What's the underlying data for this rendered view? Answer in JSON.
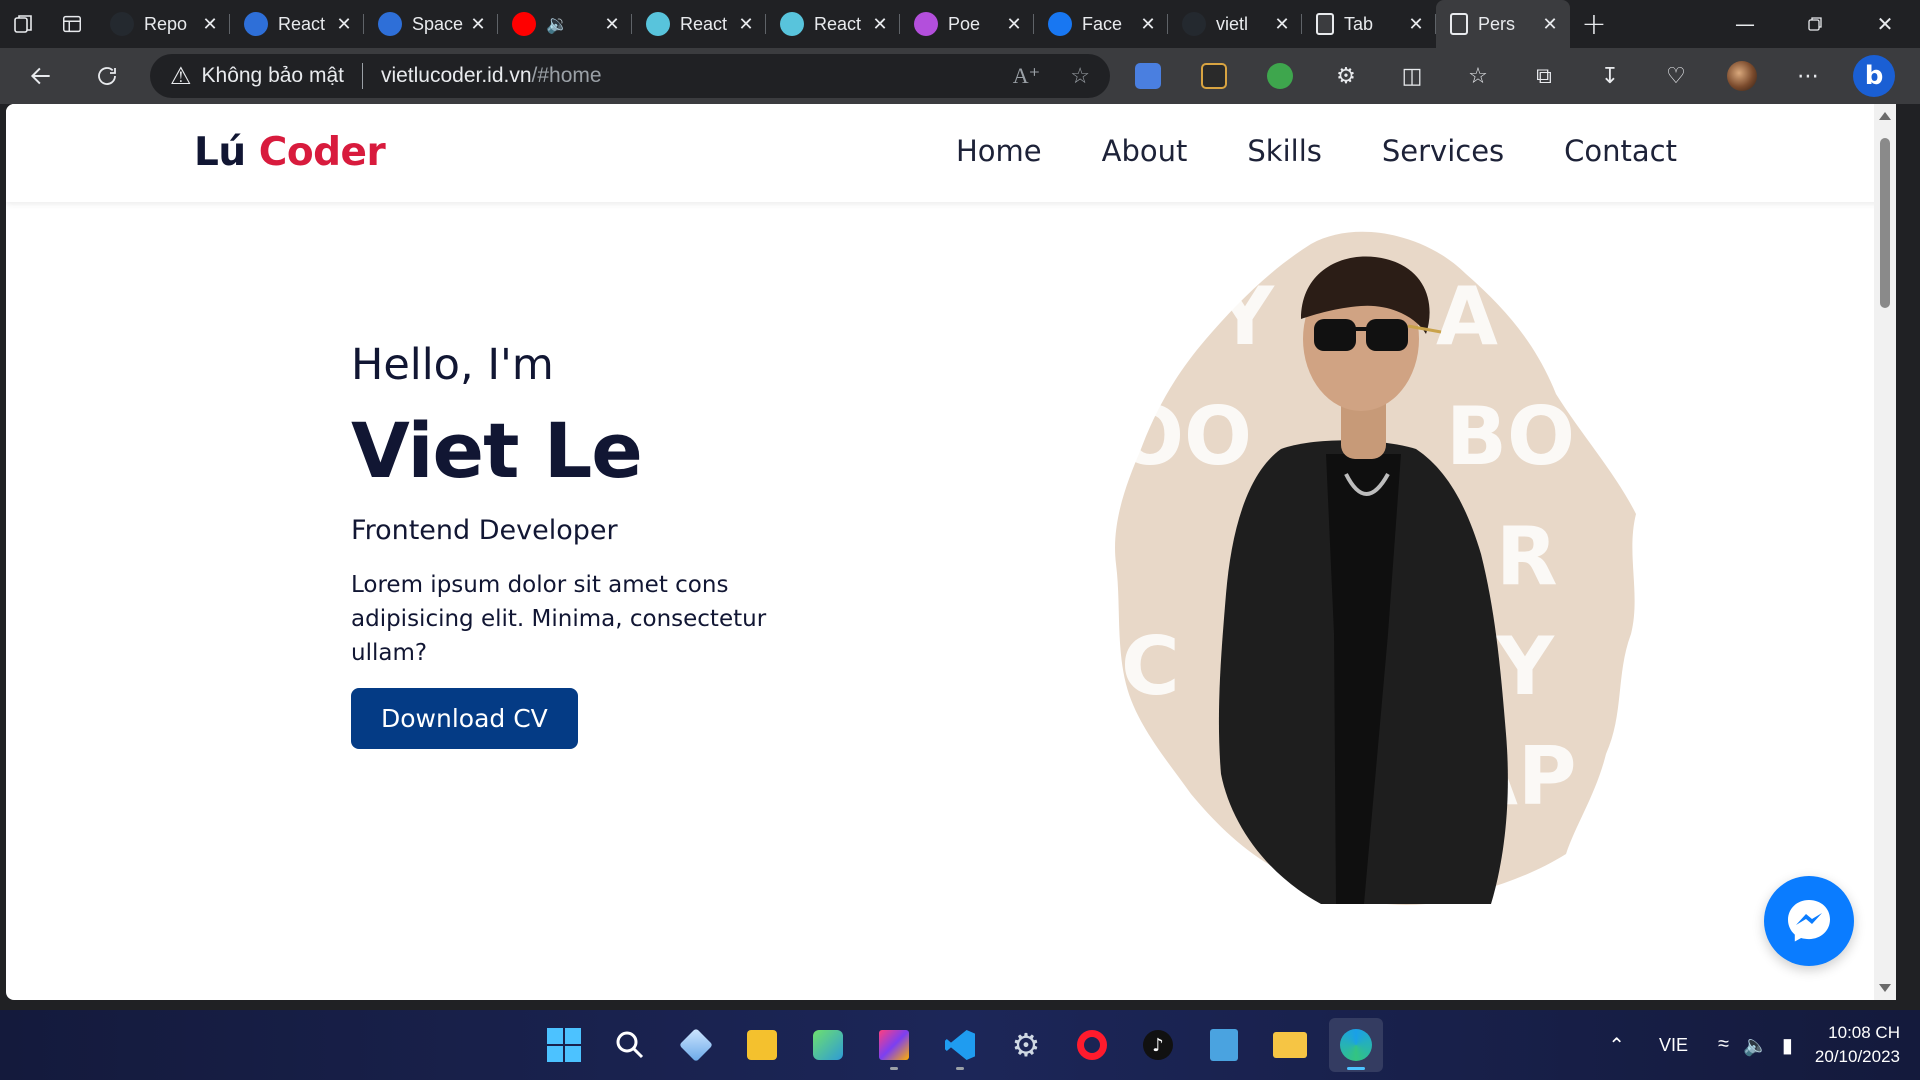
{
  "browser": {
    "tabs": [
      {
        "title": "Repo",
        "favicon": "github-icon",
        "color": "#24292f",
        "active": false
      },
      {
        "title": "React",
        "favicon": "material-ui-icon",
        "color": "#2e6fd8",
        "active": false
      },
      {
        "title": "Space",
        "favicon": "material-ui-icon",
        "color": "#2e6fd8",
        "active": false
      },
      {
        "title": "",
        "favicon": "youtube-icon",
        "color": "#ff0000",
        "active": false,
        "muted_icon": "speaker-icon"
      },
      {
        "title": "React",
        "favicon": "react-icon",
        "color": "#58c4dc",
        "active": false
      },
      {
        "title": "React",
        "favicon": "react-icon",
        "color": "#58c4dc",
        "active": false
      },
      {
        "title": "Poe",
        "favicon": "poe-icon",
        "color": "#b34fdc",
        "active": false
      },
      {
        "title": "Face",
        "favicon": "facebook-icon",
        "color": "#1877f2",
        "active": false
      },
      {
        "title": "vietl",
        "favicon": "github-icon",
        "color": "#24292f",
        "active": false
      },
      {
        "title": "Tab",
        "favicon": "tab-icon",
        "color": "#3b3c3f",
        "active": false
      },
      {
        "title": "Pers",
        "favicon": "page-icon",
        "color": "#3b3c3f",
        "active": true
      }
    ],
    "address": {
      "security_label": "Không bảo mật",
      "host": "vietlucoder.id.vn",
      "path": "/#home"
    }
  },
  "site": {
    "logo_part1": "Lú",
    "logo_part2": "Coder",
    "nav": [
      "Home",
      "About",
      "Skills",
      "Services",
      "Contact"
    ],
    "hero": {
      "greeting": "Hello, I'm",
      "name": "Viet Le",
      "role": "Frontend Developer",
      "description": "Lorem ipsum dolor sit amet cons adipisicing elit. Minima, consectetur ullam?",
      "cta": "Download CV"
    },
    "colors": {
      "brand_red": "#d81b3d",
      "navy": "#111633",
      "cta_blue": "#043b85",
      "messenger_blue": "#0a7cff"
    }
  },
  "taskbar": {
    "language": "VIE",
    "time": "10:08 CH",
    "date": "20/10/2023"
  }
}
